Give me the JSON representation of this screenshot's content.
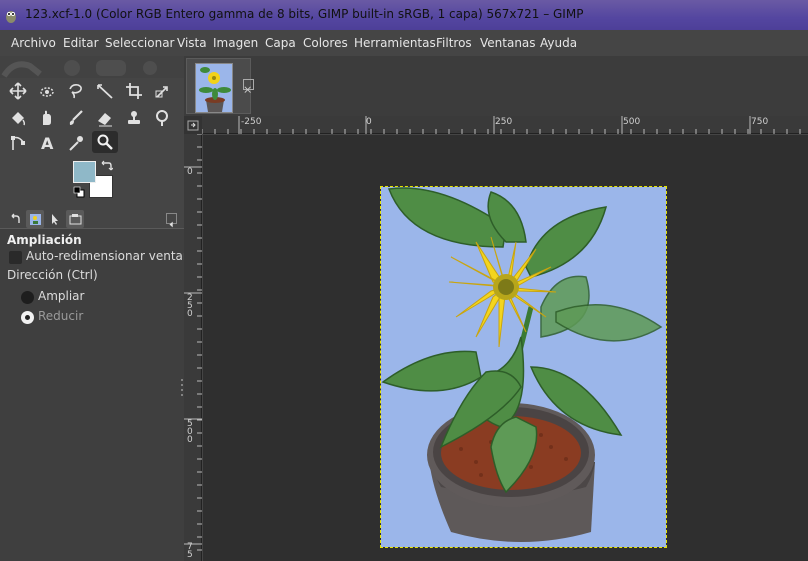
{
  "window": {
    "title": "123.xcf-1.0 (Color RGB Entero gamma de 8 bits, GIMP built-in sRGB, 1 capa) 567x721 – GIMP"
  },
  "menubar": {
    "items": [
      "Archivo",
      "Editar",
      "Seleccionar",
      "Vista",
      "Imagen",
      "Capa",
      "Colores",
      "Herramientas",
      "Filtros",
      "Ventanas",
      "Ayuda"
    ]
  },
  "toolbox": {
    "tools": [
      "move-tool",
      "ellipse-select-tool",
      "free-select-tool",
      "measure-tool",
      "crop-tool",
      "transform-tool",
      "bucket-fill-tool",
      "paintbrush-tool",
      "eraser-tool",
      "clone-tool",
      "smudge-tool",
      "paths-tool",
      "text-tool",
      "color-picker-tool",
      "zoom-tool"
    ],
    "active_tool": "zoom-tool",
    "foreground_color": "#8fb8c8",
    "background_color": "#ffffff"
  },
  "tool_options": {
    "title": "Ampliación",
    "auto_resize_label": "Auto-redimensionar ventana",
    "auto_resize_checked": false,
    "direction_label": "Dirección  (Ctrl)",
    "zoom_in_label": "Ampliar",
    "zoom_out_label": "Reducir",
    "selected_direction": "Reducir"
  },
  "rulers": {
    "horizontal": [
      "-250",
      "0",
      "250",
      "500",
      "750"
    ],
    "vertical": [
      "0",
      "250",
      "500",
      "75"
    ]
  },
  "colors": {
    "canvas_background": "#9bb6ea",
    "accent_title": "#5446a0"
  }
}
